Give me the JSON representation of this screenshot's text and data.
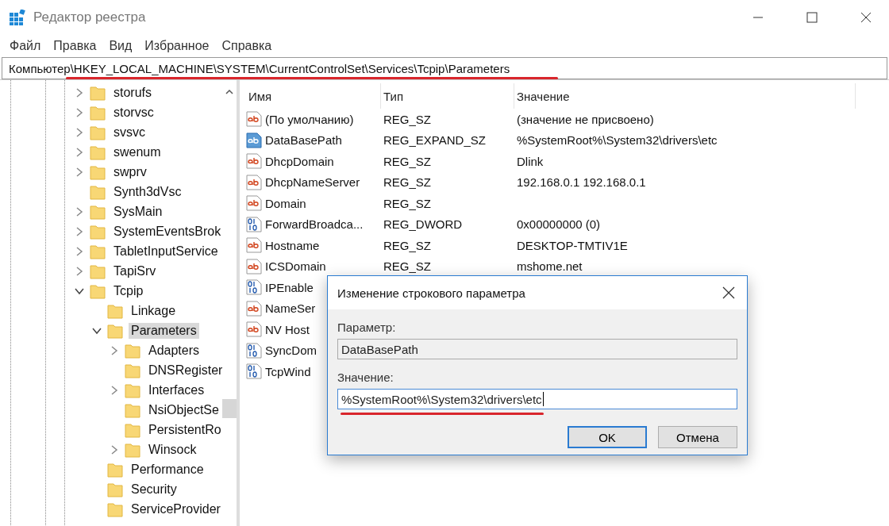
{
  "window": {
    "title": "Редактор реестра"
  },
  "menu": [
    "Файл",
    "Правка",
    "Вид",
    "Избранное",
    "Справка"
  ],
  "address": "Компьютер\\HKEY_LOCAL_MACHINE\\SYSTEM\\CurrentControlSet\\Services\\Tcpip\\Parameters",
  "tree": [
    {
      "label": "storufs",
      "has_children": true,
      "expanded": false,
      "selected": false
    },
    {
      "label": "storvsc",
      "has_children": true,
      "expanded": false,
      "selected": false
    },
    {
      "label": "svsvc",
      "has_children": true,
      "expanded": false,
      "selected": false
    },
    {
      "label": "swenum",
      "has_children": true,
      "expanded": false,
      "selected": false
    },
    {
      "label": "swprv",
      "has_children": true,
      "expanded": false,
      "selected": false
    },
    {
      "label": "Synth3dVsc",
      "has_children": false,
      "selected": false
    },
    {
      "label": "SysMain",
      "has_children": true,
      "expanded": false,
      "selected": false
    },
    {
      "label": "SystemEventsBrok",
      "has_children": true,
      "expanded": false,
      "selected": false
    },
    {
      "label": "TabletInputService",
      "has_children": true,
      "expanded": false,
      "selected": false
    },
    {
      "label": "TapiSrv",
      "has_children": true,
      "expanded": false,
      "selected": false
    },
    {
      "label": "Tcpip",
      "has_children": true,
      "expanded": true,
      "selected": false,
      "children": [
        {
          "label": "Linkage",
          "has_children": false,
          "selected": false
        },
        {
          "label": "Parameters",
          "has_children": true,
          "expanded": true,
          "selected": true,
          "children": [
            {
              "label": "Adapters",
              "has_children": true,
              "expanded": false,
              "selected": false
            },
            {
              "label": "DNSRegister",
              "has_children": false,
              "selected": false
            },
            {
              "label": "Interfaces",
              "has_children": true,
              "expanded": false,
              "selected": false
            },
            {
              "label": "NsiObjectSe",
              "has_children": false,
              "selected": false
            },
            {
              "label": "PersistentRo",
              "has_children": false,
              "selected": false
            },
            {
              "label": "Winsock",
              "has_children": true,
              "expanded": false,
              "selected": false
            }
          ]
        },
        {
          "label": "Performance",
          "has_children": false,
          "selected": false
        },
        {
          "label": "Security",
          "has_children": false,
          "selected": false
        },
        {
          "label": "ServiceProvider",
          "has_children": false,
          "selected": false
        }
      ]
    }
  ],
  "table": {
    "columns": [
      "Имя",
      "Тип",
      "Значение"
    ],
    "rows": [
      {
        "kind": "string",
        "selected": false,
        "name": "(По умолчанию)",
        "type": "REG_SZ",
        "value": "(значение не присвоено)"
      },
      {
        "kind": "string",
        "selected": true,
        "name": "DataBasePath",
        "type": "REG_EXPAND_SZ",
        "value": "%SystemRoot%\\System32\\drivers\\etc"
      },
      {
        "kind": "string",
        "selected": false,
        "name": "DhcpDomain",
        "type": "REG_SZ",
        "value": "Dlink"
      },
      {
        "kind": "string",
        "selected": false,
        "name": "DhcpNameServer",
        "type": "REG_SZ",
        "value": "192.168.0.1 192.168.0.1"
      },
      {
        "kind": "string",
        "selected": false,
        "name": "Domain",
        "type": "REG_SZ"
      },
      {
        "kind": "binary",
        "selected": false,
        "name": "ForwardBroadca...",
        "type": "REG_DWORD",
        "value": "0x00000000 (0)"
      },
      {
        "kind": "string",
        "selected": false,
        "name": "Hostname",
        "type": "REG_SZ",
        "value": "DESKTOP-TMTIV1E"
      },
      {
        "kind": "string",
        "selected": false,
        "name": "ICSDomain",
        "type": "REG_SZ",
        "value": "mshome.net"
      },
      {
        "kind": "binary",
        "selected": false,
        "name": "IPEnable"
      },
      {
        "kind": "string",
        "selected": false,
        "name": "NameSer"
      },
      {
        "kind": "string",
        "selected": false,
        "name": "NV Host"
      },
      {
        "kind": "binary",
        "selected": false,
        "name": "SyncDom"
      },
      {
        "kind": "binary",
        "selected": false,
        "name": "TcpWind"
      }
    ]
  },
  "dialog": {
    "title": "Изменение строкового параметра",
    "name_label": "Параметр:",
    "name_value": "DataBasePath",
    "value_label": "Значение:",
    "value": "%SystemRoot%\\System32\\drivers\\etc",
    "buttons": [
      {
        "label": "OK",
        "default": true
      },
      {
        "label": "Отмена",
        "default": false
      }
    ]
  }
}
